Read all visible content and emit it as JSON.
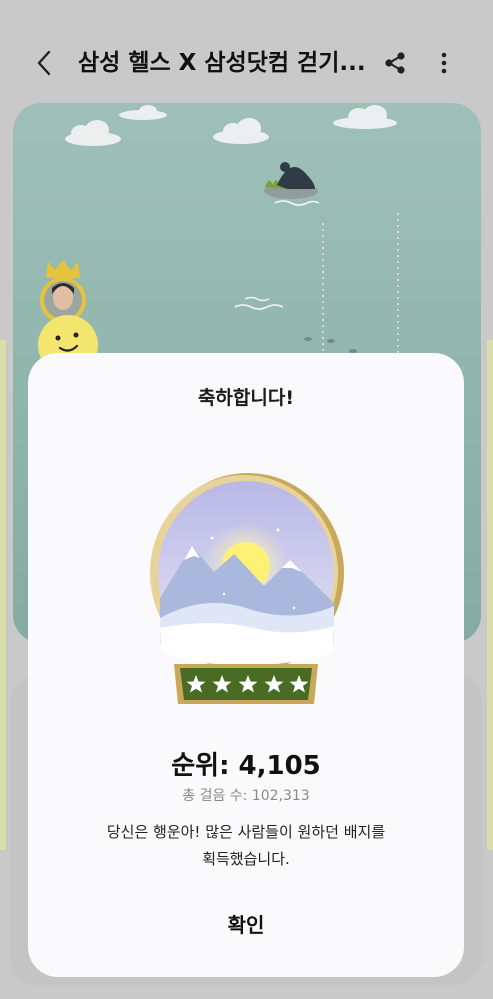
{
  "header": {
    "title": "삼성 헬스 X 삼성닷컴 걷기...",
    "back_icon": "chevron-left-icon",
    "share_icon": "share-icon",
    "more_icon": "more-vert-icon"
  },
  "dialog": {
    "title": "축하합니다!",
    "rank": "순위: 4,105",
    "steps": "총 걸음 수: 102,313",
    "message_line1": "당신은 행운아! 많은 사람들이 원하던 배지를",
    "message_line2": "획득했습니다.",
    "confirm_label": "확인",
    "badge_icon": "snow-globe-badge-icon",
    "badge_stars": 5
  },
  "colors": {
    "scene": "#8fb5ad",
    "badge_base": "#4a6b23",
    "gold": "#c9a85a",
    "smiley": "#f4e56e",
    "crown": "#e6c33a"
  }
}
